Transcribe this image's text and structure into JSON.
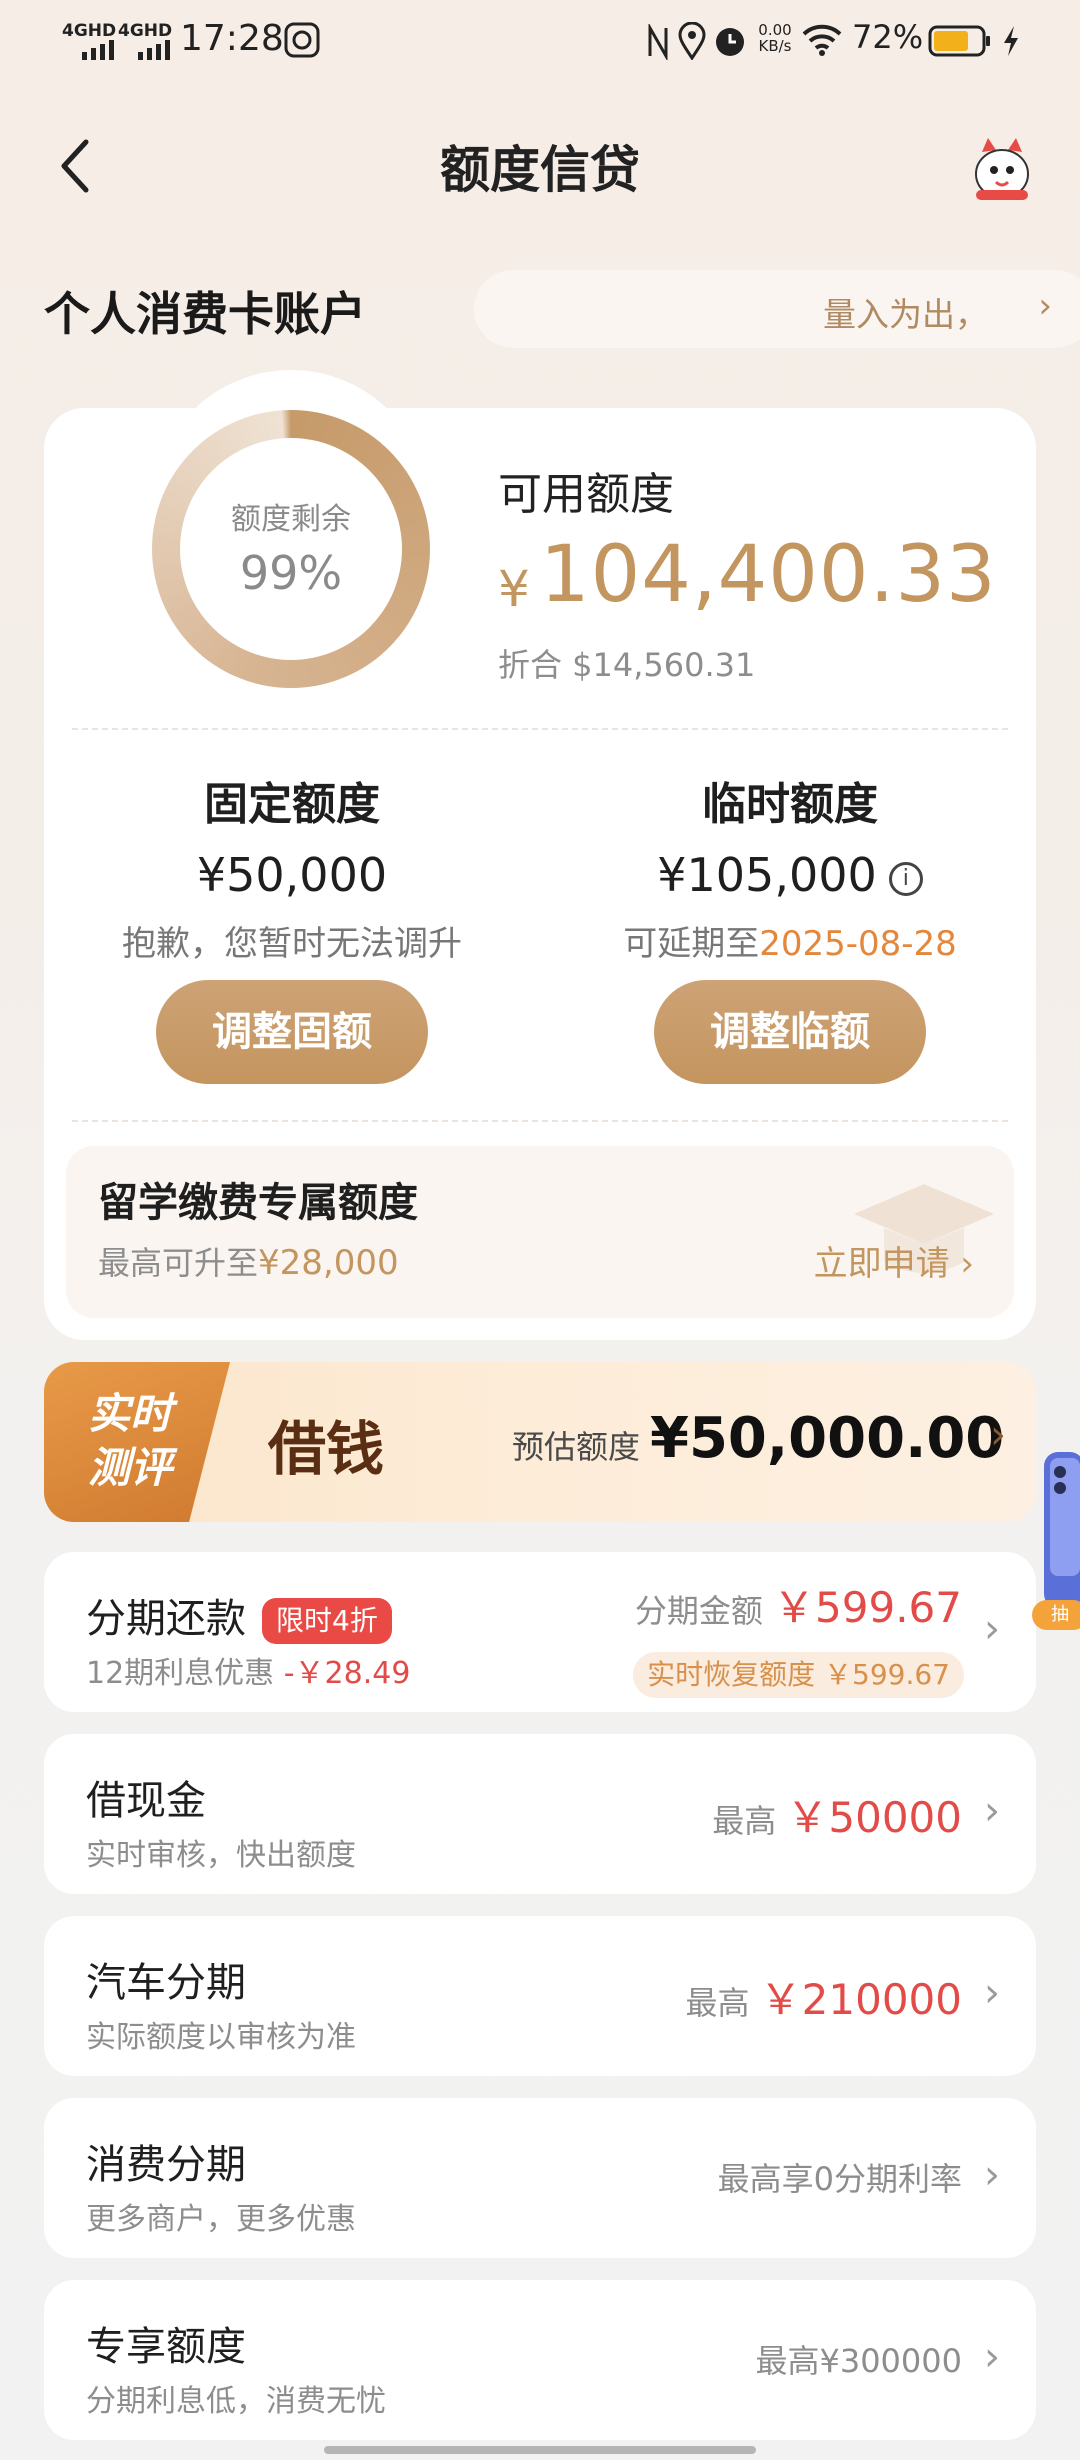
{
  "status": {
    "sig1": "4GHD",
    "sig2": "4GHD",
    "time": "17:28",
    "net_speed": "0.00",
    "net_unit": "KB/s",
    "battery": "72%"
  },
  "header": {
    "title": "额度信贷"
  },
  "account": {
    "title": "个人消费卡账户",
    "marquee": "量入为出，"
  },
  "summary": {
    "ring_label": "额度剩余",
    "ring_value": "99%",
    "ring_fraction": 0.99,
    "available_label": "可用额度",
    "currency": "¥",
    "available_amount": "104,400.33",
    "converted": "折合 $14,560.31"
  },
  "fixed": {
    "title": "固定额度",
    "amount": "¥50,000",
    "note": "抱歉，您暂时无法调升",
    "button": "调整固额"
  },
  "temp": {
    "title": "临时额度",
    "amount": "¥105,000",
    "note_prefix": "可延期至",
    "note_date": "2025-08-28",
    "button": "调整临额"
  },
  "study": {
    "title": "留学缴费专属额度",
    "sub_prefix": "最高可升至",
    "sub_amount": "¥28,000",
    "cta": "立即申请 ›"
  },
  "borrow": {
    "badge_line1": "实时",
    "badge_line2": "测评",
    "title": "借钱",
    "est_label": "预估额度",
    "est_amount": "¥50,000.00"
  },
  "list": [
    {
      "title": "分期还款",
      "tag": "限时4折",
      "sub": "12期利息优惠",
      "sub_red": "-￥28.49",
      "right_label": "分期金额",
      "right_value": "￥599.67",
      "recover": "实时恢复额度 ￥599.67"
    },
    {
      "title": "借现金",
      "sub": "实时审核，快出额度",
      "right_label": "最高",
      "right_value": "￥50000"
    },
    {
      "title": "汽车分期",
      "sub": "实际额度以审核为准",
      "right_label": "最高",
      "right_value": "￥210000"
    },
    {
      "title": "消费分期",
      "sub": "更多商户，更多优惠",
      "right_label": "最高享0分期利率"
    },
    {
      "title": "专享额度",
      "sub": "分期利息低，消费无忧",
      "right_label": "最高¥300000"
    }
  ],
  "side_float": {
    "label": "抽"
  },
  "colors": {
    "gold": "#c3955f",
    "orange": "#e3873c",
    "red": "#e24b48"
  }
}
